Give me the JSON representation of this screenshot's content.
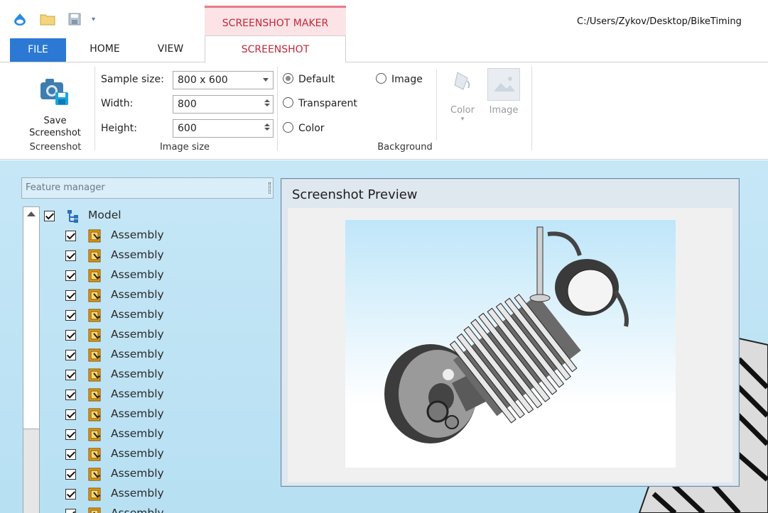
{
  "titlebar": {
    "context_tab_group": "SCREENSHOT MAKER",
    "file_path": "C:/Users/Zykov/Desktop/BikeTiming"
  },
  "tabs": [
    {
      "label": "FILE"
    },
    {
      "label": "HOME"
    },
    {
      "label": "VIEW"
    },
    {
      "label": "SCREENSHOT"
    }
  ],
  "ribbon": {
    "screenshot_group": {
      "save_label_line1": "Save",
      "save_label_line2": "Screenshot",
      "group_label": "Screenshot",
      "save_icon": "camera-save-icon"
    },
    "image_size_group": {
      "sample_size_label": "Sample size:",
      "sample_size_value": "800 x 600",
      "width_label": "Width:",
      "width_value": "800",
      "height_label": "Height:",
      "height_value": "600",
      "group_label": "Image size"
    },
    "background_group": {
      "default_label": "Default",
      "image_radio_label": "Image",
      "transparent_label": "Transparent",
      "color_radio_label": "Color",
      "selected": "Default",
      "color_button_label": "Color",
      "image_button_label": "Image",
      "group_label": "Background"
    }
  },
  "feature_manager": {
    "search_placeholder": "Feature manager",
    "root_label": "Model",
    "items": [
      {
        "label": "Assembly"
      },
      {
        "label": "Assembly"
      },
      {
        "label": "Assembly"
      },
      {
        "label": "Assembly"
      },
      {
        "label": "Assembly"
      },
      {
        "label": "Assembly"
      },
      {
        "label": "Assembly"
      },
      {
        "label": "Assembly"
      },
      {
        "label": "Assembly"
      },
      {
        "label": "Assembly"
      },
      {
        "label": "Assembly"
      },
      {
        "label": "Assembly"
      },
      {
        "label": "Assembly"
      },
      {
        "label": "Assembly"
      },
      {
        "label": "Assembly"
      }
    ]
  },
  "preview": {
    "title": "Screenshot Preview"
  },
  "colors": {
    "file_tab": "#2b79d4",
    "context_accent": "#c0283a",
    "workspace_bg": "#c6e7f6"
  }
}
